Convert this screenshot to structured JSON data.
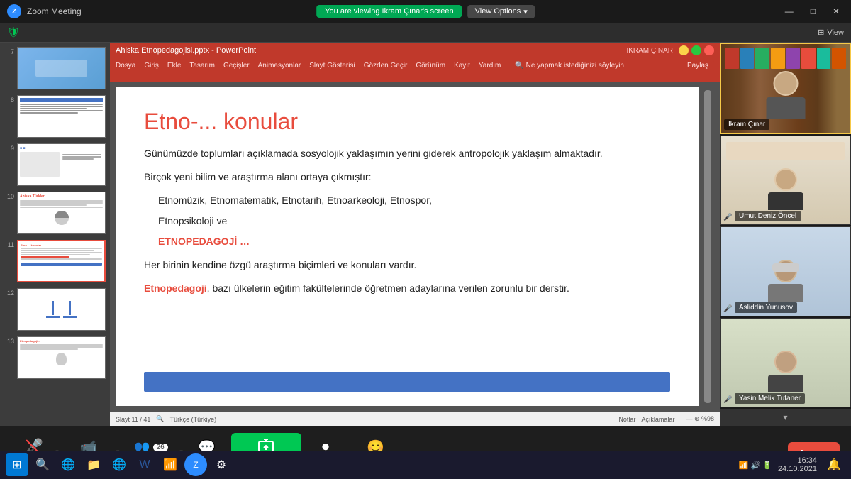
{
  "titlebar": {
    "title": "Zoom Meeting",
    "viewing_text": "You are viewing Ikram Çınar's screen",
    "view_options": "View Options",
    "view_label": "View",
    "minimize": "—",
    "maximize": "□",
    "close": "✕"
  },
  "powerpoint": {
    "file_title": "Ahiska Etnopedagojisi.pptx - PowerPoint",
    "user": "IKRAM ÇINAR",
    "menu_items": [
      "Dosya",
      "Giriş",
      "Ekle",
      "Tasarım",
      "Geçişler",
      "Animasyonlar",
      "Slayt Gösterisi",
      "Gözden Geçir",
      "Görünüm",
      "Kayıt",
      "Yardım",
      "Ne yapmak istediğinizi söyleyin"
    ],
    "share_btn": "Paylaş",
    "slide_title": "Etno-... konular",
    "slide_body": [
      "Günümüzde toplumları açıklamada sosyolojik yaklaşımın yerini giderek antropolojik yaklaşım almaktadır.",
      "Birçok yeni bilim ve araştırma alanı ortaya çıkmıştır:",
      "Etnomüzik, Etnomatematik, Etnotarih, Etnoarkeoloji, Etnospor,",
      "Etnopsikoloji ve",
      "ETNOPEDAGOJİ …",
      "Her birinin kendine özgü araştırma biçimleri ve konuları vardır.",
      "Etnopedagoji, bazı ülkelerin eğitim fakültelerinde öğretmen adaylarına verilen zorunlu bir derstir."
    ],
    "status_left": "Slayt 11 / 41",
    "status_lang": "Türkçe (Türkiye)",
    "status_notes": "Notlar",
    "status_comments": "Açıklamalar",
    "zoom_level": "%98"
  },
  "slide_numbers": [
    "7",
    "8",
    "9",
    "10",
    "11",
    "12",
    "13"
  ],
  "participants": [
    {
      "name": "Ikram Çınar",
      "is_active_speaker": true,
      "mic_muted": false
    },
    {
      "name": "Umut Deniz Öncel",
      "is_active_speaker": false,
      "mic_muted": true
    },
    {
      "name": "Asliddin Yunusov",
      "is_active_speaker": false,
      "mic_muted": true
    },
    {
      "name": "Yasin Melik Tufaner",
      "is_active_speaker": false,
      "mic_muted": true
    }
  ],
  "toolbar": {
    "unmute_label": "Unmute",
    "stop_video_label": "Stop Video",
    "participants_label": "Participants",
    "participants_count": "26",
    "chat_label": "Chat",
    "share_screen_label": "Share Screen",
    "record_label": "Record",
    "reactions_label": "Reactions",
    "leave_label": "Leave"
  },
  "win_taskbar": {
    "time": "16:34",
    "date": "24.10.2021"
  },
  "colors": {
    "accent_red": "#e84c3d",
    "accent_blue": "#4472c4",
    "zoom_green": "#00c853",
    "active_border": "#f7c948"
  }
}
